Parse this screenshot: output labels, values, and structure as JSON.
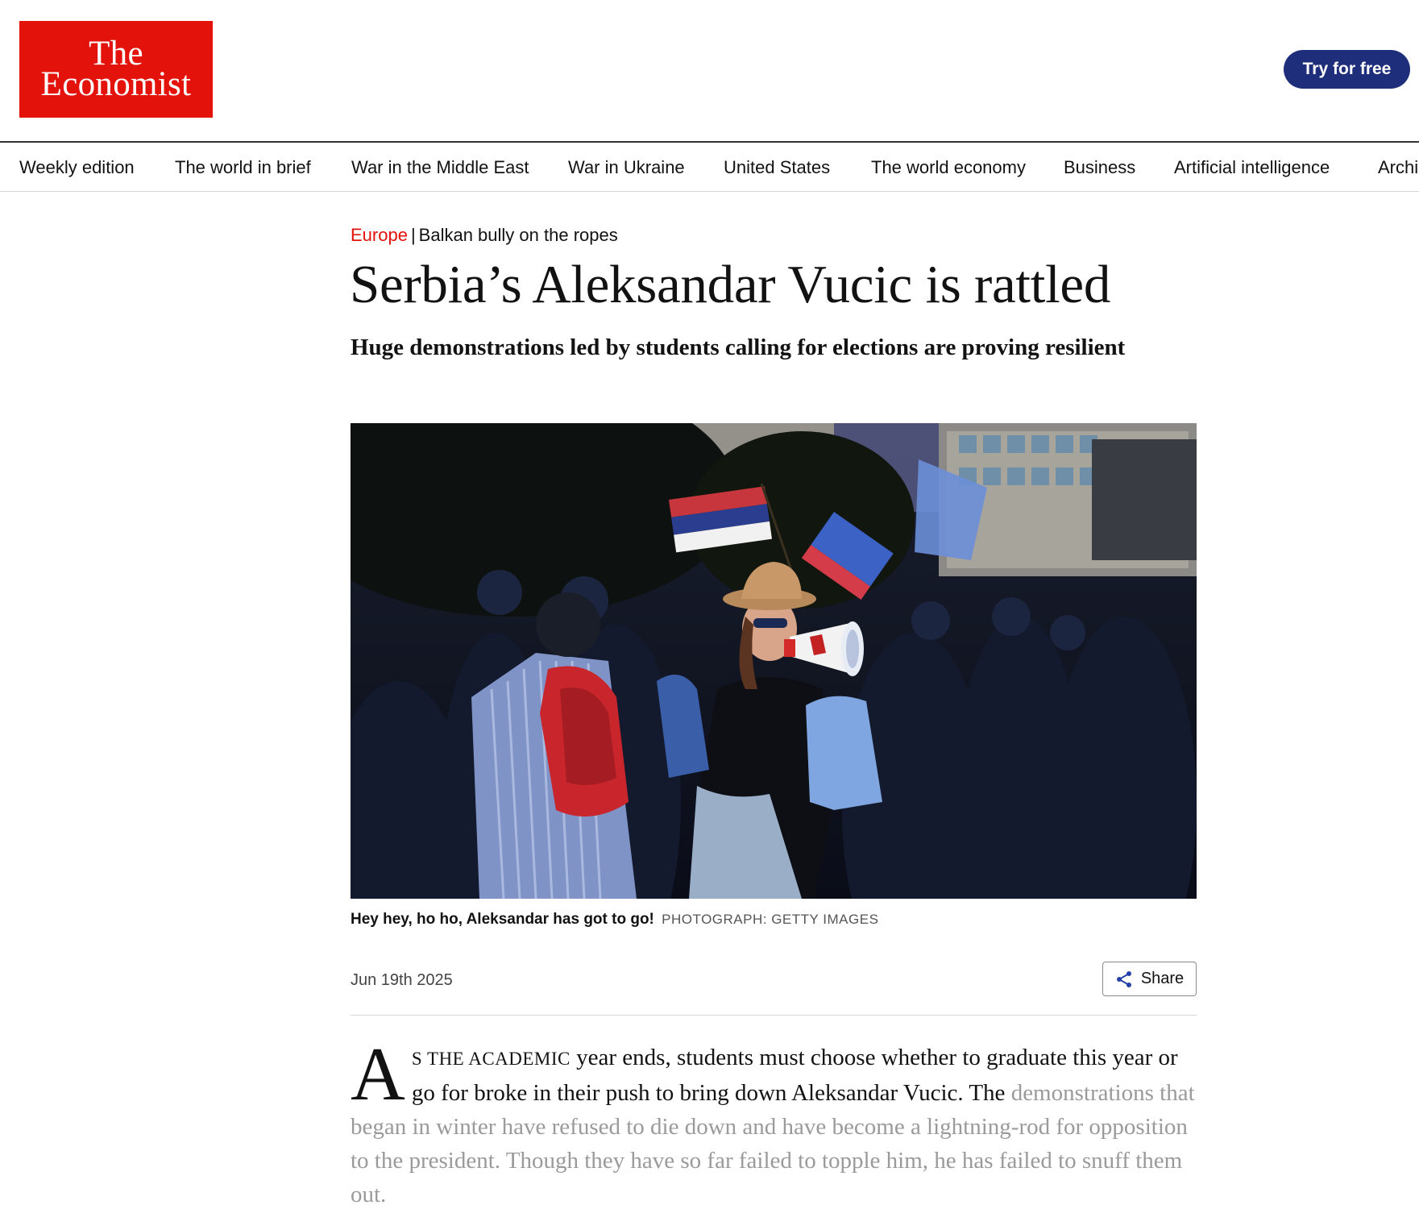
{
  "header": {
    "logo_line1": "The",
    "logo_line2": "Economist",
    "cta_label": "Try for free",
    "brand_color": "#e3120b",
    "cta_color": "#1f2e7a"
  },
  "nav": {
    "items": [
      "Weekly edition",
      "The world in brief",
      "War in the Middle East",
      "War in Ukraine",
      "United States",
      "The world economy",
      "Business",
      "Artificial intelligence",
      "Archi"
    ]
  },
  "article": {
    "section": "Europe",
    "separator": "|",
    "fly_title": "Balkan bully on the ropes",
    "headline": "Serbia’s Aleksandar Vucic is rattled",
    "subheadline": "Huge demonstrations led by students calling for elections are proving resilient",
    "caption": "Hey hey, ho ho, Aleksandar has got to go!",
    "photo_credit": "PHOTOGRAPH: GETTY IMAGES",
    "date": "Jun 19th 2025",
    "share_label": "Share",
    "dropcap": "A",
    "smallcaps_lead": "s the academic",
    "body_start": " year ends, students must choose whether to graduate this year or go for broke in their push to bring down Aleksandar Vucic. The ",
    "body_faded": "demonstrations that began in winter have refused to die down and have become a lightning-rod for opposition to the president. Though they have so far failed to topple him, he has failed to snuff them out."
  }
}
